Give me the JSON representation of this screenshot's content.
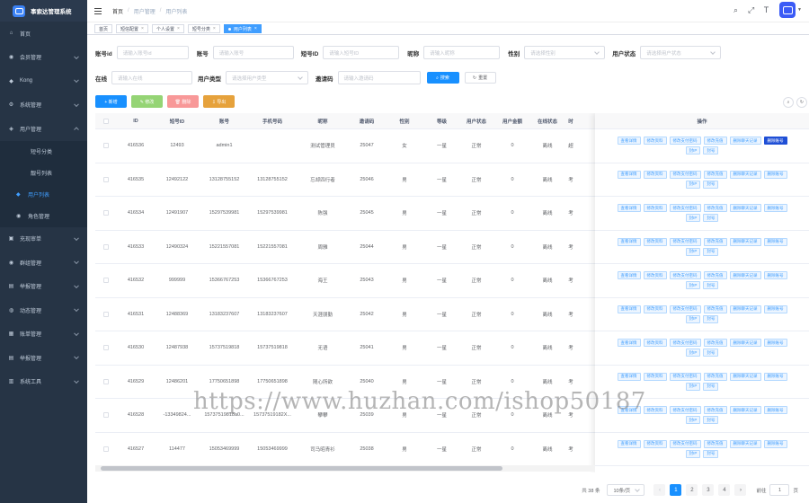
{
  "brand": {
    "title": "事索达管理系统"
  },
  "sidebar": {
    "items": [
      {
        "label": "首页",
        "icon": "home-icon",
        "glyph": "⌂"
      },
      {
        "label": "会员管理",
        "icon": "user-icon",
        "glyph": "◉"
      },
      {
        "label": "Kong",
        "icon": "diamond-icon",
        "glyph": "◆"
      },
      {
        "label": "系统管理",
        "icon": "settings-icon",
        "glyph": "⚙"
      },
      {
        "label": "用户管理",
        "icon": "user-group-icon",
        "glyph": "◈"
      }
    ],
    "submenu": [
      {
        "label": "短号分类"
      },
      {
        "label": "靓号列表"
      },
      {
        "label": "用户列表",
        "icon": "user-list-icon",
        "glyph": "◆"
      },
      {
        "label": "角色管理",
        "icon": "role-icon",
        "glyph": "◉"
      }
    ],
    "items_after": [
      {
        "label": "充现审单",
        "icon": "doc-icon",
        "glyph": "▣"
      },
      {
        "label": "群组管理",
        "icon": "group-icon",
        "glyph": "◉"
      },
      {
        "label": "举报管理",
        "icon": "report-icon",
        "glyph": "▤"
      },
      {
        "label": "动态管理",
        "icon": "moment-icon",
        "glyph": "◍"
      },
      {
        "label": "账单管理",
        "icon": "bill-icon",
        "glyph": "▦"
      },
      {
        "label": "举报管理",
        "icon": "report2-icon",
        "glyph": "▤"
      },
      {
        "label": "系统工具",
        "icon": "tool-icon",
        "glyph": "▥"
      }
    ]
  },
  "header": {
    "breadcrumb": [
      "首页",
      "用户管理",
      "用户列表"
    ]
  },
  "tags": [
    {
      "label": "首页",
      "closable": false
    },
    {
      "label": "短信配置",
      "closable": true
    },
    {
      "label": "个人设置",
      "closable": true
    },
    {
      "label": "短号分类",
      "closable": true
    },
    {
      "label": "用户列表",
      "closable": true,
      "active": true
    }
  ],
  "search": {
    "fields_row1": [
      {
        "label": "账号id",
        "placeholder": "请输入账号id",
        "width": 0
      },
      {
        "label": "账号",
        "placeholder": "请输入账号",
        "width": 0
      },
      {
        "label": "短号ID",
        "placeholder": "请输入短号ID",
        "width": 0
      },
      {
        "label": "昵称",
        "placeholder": "请输入昵称",
        "width": 0
      },
      {
        "label": "性别",
        "placeholder": "请选择性别",
        "select": true
      },
      {
        "label": "用户状态",
        "placeholder": "请选择用户状态",
        "select": true
      }
    ],
    "fields_row2": [
      {
        "label": "在线",
        "placeholder": "请输入在线"
      },
      {
        "label": "用户类型",
        "placeholder": "请选择用户类型",
        "select": true
      },
      {
        "label": "邀请码",
        "placeholder": "请输入邀请码"
      }
    ],
    "search_label": "搜索",
    "reset_label": "重置"
  },
  "toolbar": {
    "add": "+ 新增",
    "edit": "✎ 修改",
    "delete": "🗑 删除",
    "export": "⇩ 导出"
  },
  "table": {
    "columns": [
      "ID",
      "短号ID",
      "账号",
      "手机号码",
      "昵称",
      "邀请码",
      "性别",
      "等级",
      "用户状态",
      "用户金额",
      "在线状态",
      "时"
    ],
    "ops_header": "操作",
    "rows": [
      [
        "416536",
        "12493",
        "admin1",
        "",
        "测试管理员",
        "25047",
        "女",
        "一星",
        "正常",
        "0",
        "离线",
        "超"
      ],
      [
        "416535",
        "12492122",
        "13128755152",
        "13128755152",
        "忘却四行者",
        "25046",
        "男",
        "一星",
        "正常",
        "0",
        "离线",
        "考"
      ],
      [
        "416534",
        "12491907",
        "15297539981",
        "15297539981",
        "陈强",
        "25045",
        "男",
        "一星",
        "正常",
        "0",
        "离线",
        "考"
      ],
      [
        "416533",
        "12490324",
        "15221557081",
        "15221557081",
        "周雅",
        "25044",
        "男",
        "一星",
        "正常",
        "0",
        "离线",
        "考"
      ],
      [
        "416532",
        "999999",
        "15366767253",
        "15366767253",
        "海王",
        "25043",
        "男",
        "一星",
        "正常",
        "0",
        "离线",
        "考"
      ],
      [
        "416531",
        "12488369",
        "13183237607",
        "13183237607",
        "天涯朋勤",
        "25042",
        "男",
        "一星",
        "正常",
        "0",
        "离线",
        "考"
      ],
      [
        "416530",
        "12487938",
        "15737519818",
        "15737519818",
        "无语",
        "25041",
        "男",
        "一星",
        "正常",
        "0",
        "离线",
        "考"
      ],
      [
        "416529",
        "12486201",
        "17750651898",
        "17750651898",
        "随心所欲",
        "25040",
        "男",
        "一星",
        "正常",
        "0",
        "离线",
        "考"
      ],
      [
        "416528",
        "-13349824...",
        "15737519818a0...",
        "15737519182X...",
        "攀攀",
        "25039",
        "男",
        "一星",
        "正常",
        "0",
        "离线",
        "考"
      ],
      [
        "416527",
        "114477",
        "15053469999",
        "15053469999",
        "司马昭青衫",
        "25038",
        "男",
        "一星",
        "正常",
        "0",
        "离线",
        "考"
      ]
    ],
    "ops": [
      "查看详情",
      "修改资料",
      "修改支付密码",
      "修改充值",
      "删除聊天记录",
      "删除账号",
      "封IP",
      "封号"
    ]
  },
  "watermark": "https://www.huzhan.com/ishop50187",
  "pager": {
    "total": "共 38 条",
    "size": "10条/页",
    "prev": "‹",
    "next": "›",
    "pages": [
      "1",
      "2",
      "3",
      "4"
    ],
    "jump_label": "前往",
    "jump_value": "1",
    "jump_suffix": "页"
  }
}
